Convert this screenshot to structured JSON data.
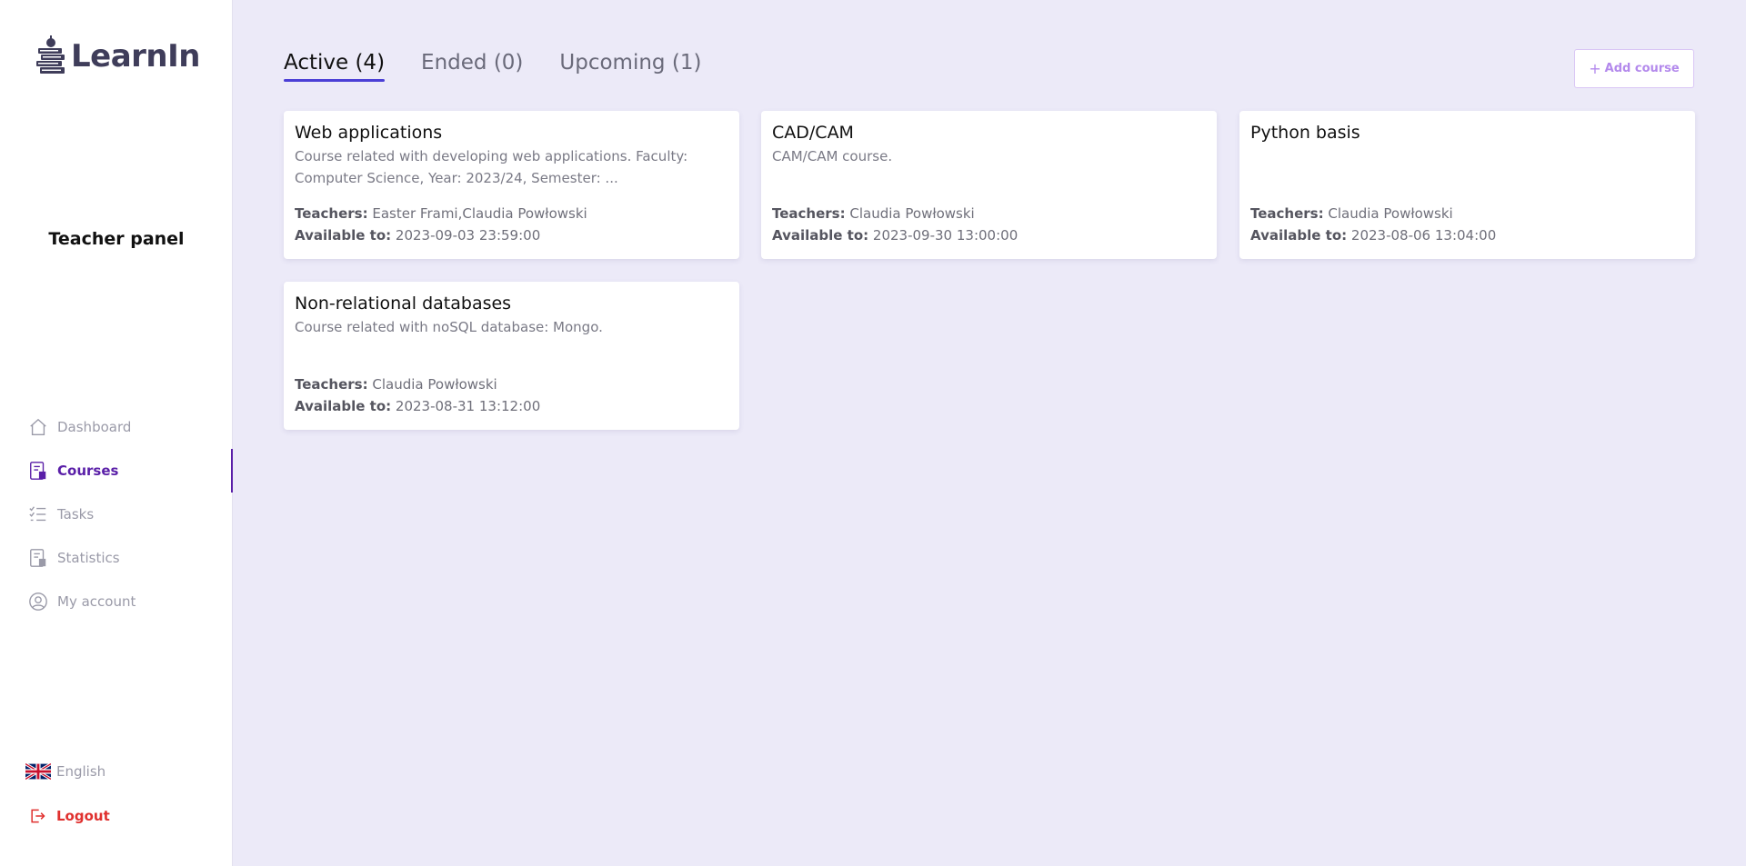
{
  "app": {
    "name": "LearnIn"
  },
  "sidebar": {
    "panel_title": "Teacher panel",
    "items": [
      {
        "label": "Dashboard",
        "icon": "home-icon",
        "active": false
      },
      {
        "label": "Courses",
        "icon": "courses-icon",
        "active": true
      },
      {
        "label": "Tasks",
        "icon": "tasks-icon",
        "active": false
      },
      {
        "label": "Statistics",
        "icon": "statistics-icon",
        "active": false
      },
      {
        "label": "My account",
        "icon": "user-icon",
        "active": false
      }
    ],
    "language": "English",
    "logout": "Logout"
  },
  "tabs": [
    {
      "label": "Active (4)",
      "active": true
    },
    {
      "label": "Ended (0)",
      "active": false
    },
    {
      "label": "Upcoming (1)",
      "active": false
    }
  ],
  "toolbar": {
    "add_course_label": "Add course"
  },
  "labels": {
    "teachers": "Teachers:",
    "available_to": "Available to:"
  },
  "courses": [
    {
      "title": "Web applications",
      "description": "Course related with developing web applications. Faculty: Computer Science, Year: 2023/24, Semester: ...",
      "teachers": "Easter Frami,Claudia Powłowski",
      "available_to": "2023-09-03 23:59:00"
    },
    {
      "title": "CAD/CAM",
      "description": "CAM/CAM course.",
      "teachers": "Claudia Powłowski",
      "available_to": "2023-09-30 13:00:00"
    },
    {
      "title": "Python basis",
      "description": "",
      "teachers": "Claudia Powłowski",
      "available_to": "2023-08-06 13:04:00"
    },
    {
      "title": "Non-relational databases",
      "description": "Course related with noSQL database: Mongo.",
      "teachers": "Claudia Powłowski",
      "available_to": "2023-08-31 13:12:00"
    }
  ],
  "colors": {
    "accent": "#5a1fa8",
    "tab_underline": "#4b3fd6",
    "background": "#eceaf8",
    "logout": "#e0302e",
    "add_button": "#b389ec"
  }
}
